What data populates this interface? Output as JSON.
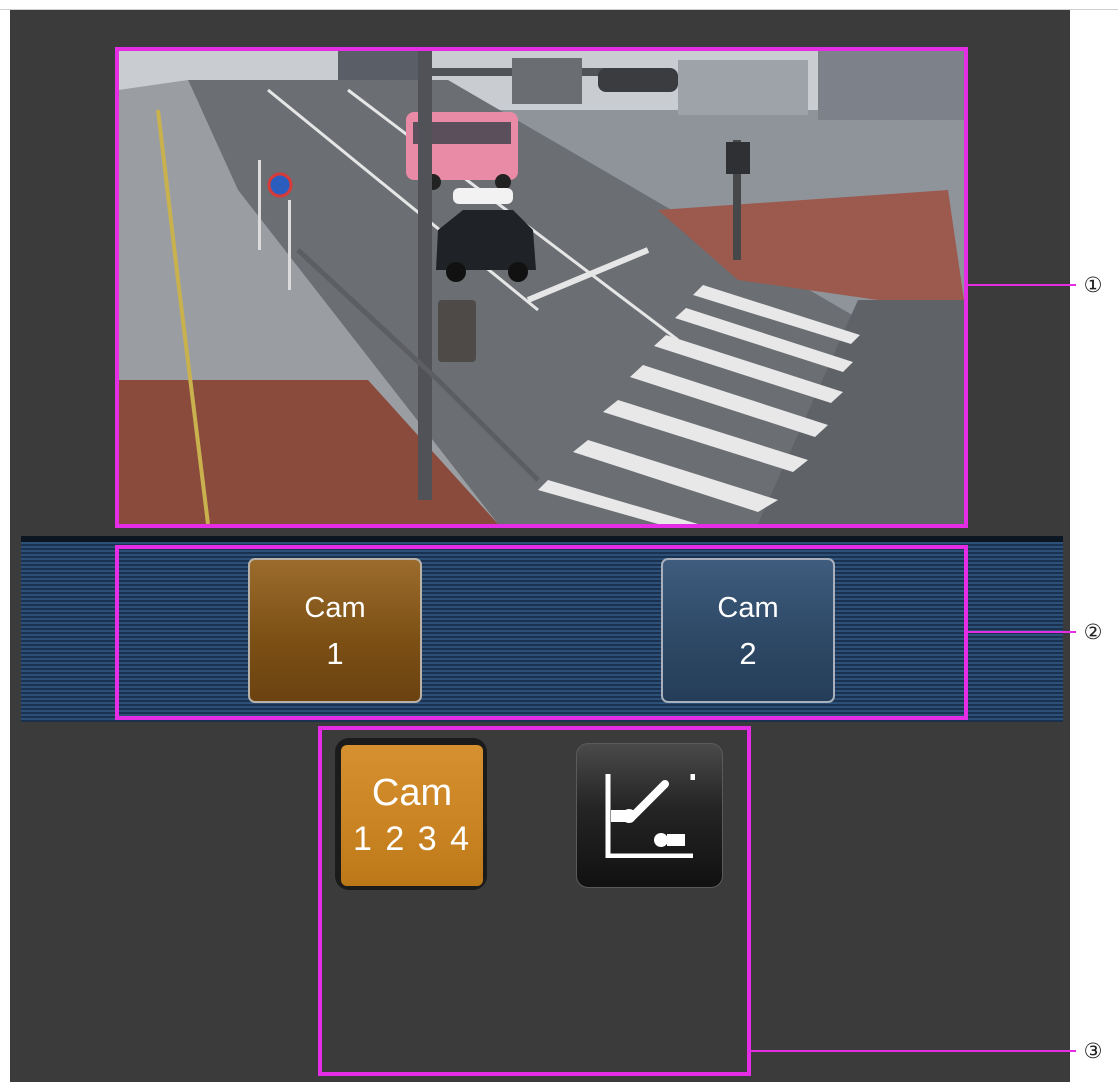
{
  "camera_view": {
    "image": "street-intersection-camera-image"
  },
  "camera_selector": {
    "buttons": [
      {
        "line1": "Cam",
        "line2": "1",
        "color": "#7d5015"
      },
      {
        "line1": "Cam",
        "line2": "2",
        "color": "#2e4966"
      }
    ]
  },
  "controls": {
    "multi_screen": {
      "line1": "Cam",
      "line2": "1 2 3 4",
      "color": "#c98322"
    },
    "switch_icon": "single-screen-switch-icon"
  },
  "callouts": [
    "①",
    "②",
    "③"
  ],
  "colors": {
    "highlight": "#e62de6",
    "panel": "#3b3b3b",
    "strip": "#2d5079"
  }
}
